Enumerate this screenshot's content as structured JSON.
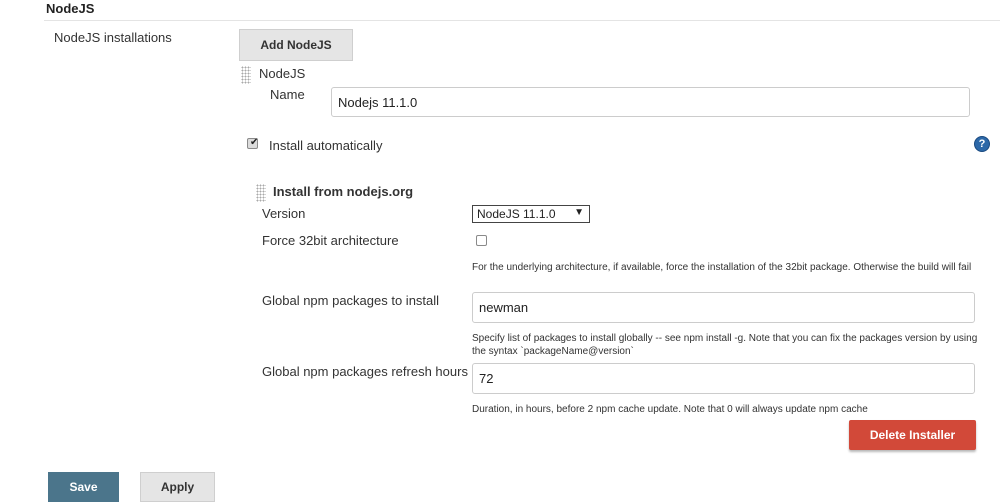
{
  "section": {
    "title": "NodeJS"
  },
  "installations": {
    "label": "NodeJS installations",
    "add_button": "Add NodeJS",
    "item_header": "NodeJS",
    "name_label": "Name",
    "name_value": "Nodejs 11.1.0",
    "install_auto_label": "Install automatically",
    "install_auto_checked": true,
    "help_icon": "question-mark-icon"
  },
  "installer": {
    "header": "Install from nodejs.org",
    "version_label": "Version",
    "version_selected": "NodeJS 11.1.0",
    "force32_label": "Force 32bit architecture",
    "force32_checked": false,
    "force32_help": "For the underlying architecture, if available, force the installation of the 32bit package. Otherwise the build will fail",
    "npm_label": "Global npm packages to install",
    "npm_value": "newman",
    "npm_help": "Specify list of packages to install globally -- see npm install -g. Note that you can fix the packages version by using the syntax `packageName@version`",
    "refresh_label": "Global npm packages refresh hours",
    "refresh_value": "72",
    "refresh_help": "Duration, in hours, before 2 npm cache update. Note that 0 will always update npm cache",
    "delete_button": "Delete Installer"
  },
  "footer": {
    "save_label": "Save",
    "apply_label": "Apply"
  },
  "colors": {
    "save": "#4b758b",
    "delete": "#d24939",
    "help_icon": "#2c68a8",
    "button_grey": "#e5e5e5"
  }
}
